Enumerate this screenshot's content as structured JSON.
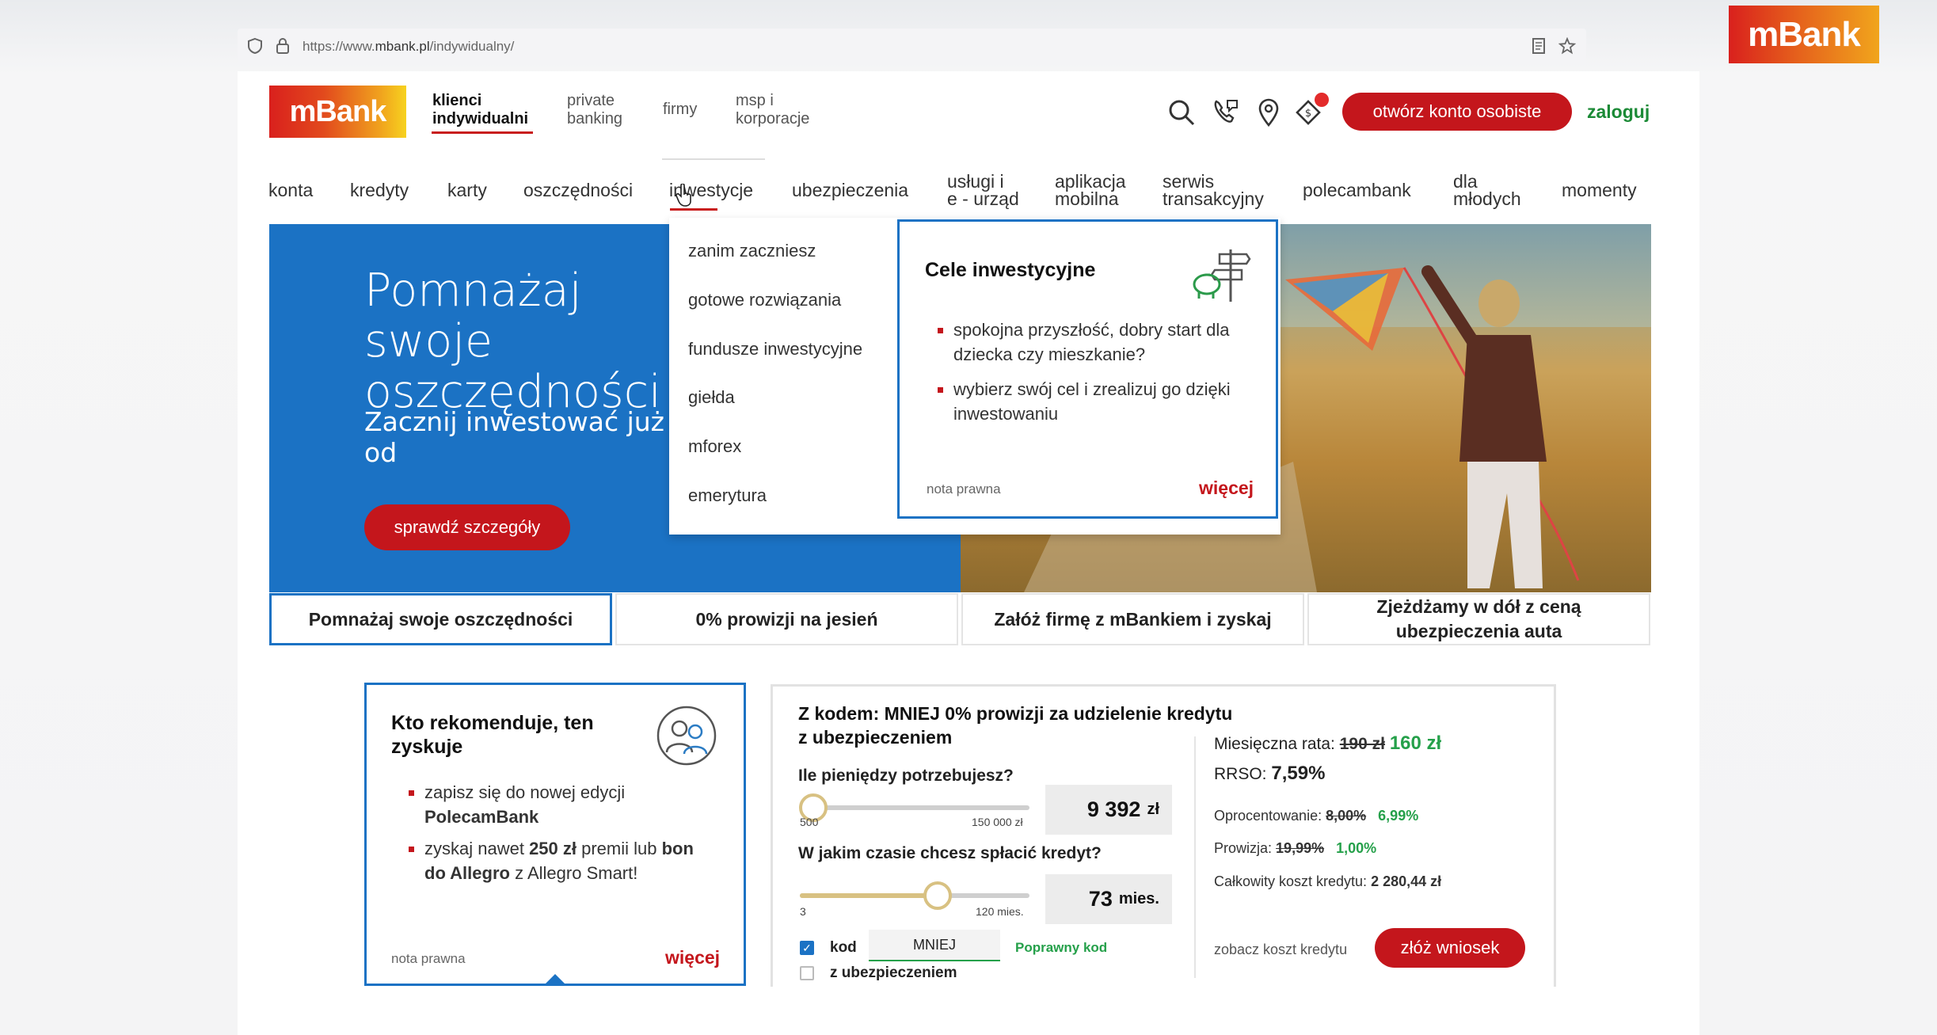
{
  "browser": {
    "url_prefix": "https://www.",
    "url_domain": "mbank.pl",
    "url_path": "/indywidualny/"
  },
  "corner_logo": "mBank",
  "header": {
    "logo": "mBank",
    "segments": [
      "klienci\nindywidualni",
      "private\nbanking",
      "firmy",
      "msp i\nkorporacje"
    ],
    "open_account": "otwórz konto osobiste",
    "login": "zaloguj",
    "icons": [
      "search-icon",
      "phone-chat-icon",
      "location-pin-icon",
      "currency-exchange-icon"
    ]
  },
  "nav": [
    "konta",
    "kredyty",
    "karty",
    "oszczędności",
    "inwestycje",
    "ubezpieczenia",
    "usługi i\ne - urząd",
    "aplikacja\nmobilna",
    "serwis\ntransakcyjny",
    "polecambank",
    "dla\nmłodych",
    "momenty"
  ],
  "dropdown": {
    "items": [
      "zanim zaczniesz",
      "gotowe rozwiązania",
      "fundusze inwestycyjne",
      "giełda",
      "mforex",
      "emerytura"
    ],
    "panel_title": "Cele inwestycyjne",
    "bullets": [
      "spokojna przyszłość, dobry start dla dziecka czy mieszkanie?",
      "wybierz swój cel i zrealizuj go dzięki inwestowaniu"
    ],
    "legal": "nota prawna",
    "more": "więcej"
  },
  "hero": {
    "title": "Pomnażaj swoje oszczędności",
    "subtitle": "Zacznij inwestować już od",
    "button": "sprawdź szczegóły"
  },
  "tabs": [
    "Pomnażaj swoje oszczędności",
    "0% prowizji na jesień",
    "Załóż firmę z mBankiem i zyskaj",
    "Zjeżdżamy w dół z ceną ubezpieczenia auta"
  ],
  "recommend": {
    "title": "Kto rekomenduje, ten zyskuje",
    "b1_pre": "zapisz się do nowej edycji ",
    "b1_bold": "PolecamBank",
    "b2_pre": "zyskaj nawet ",
    "b2_bold1": "250 zł",
    "b2_mid": " premii lub ",
    "b2_bold2": "bon do Allegro",
    "b2_post": " z Allegro Smart!",
    "legal": "nota prawna",
    "more": "więcej"
  },
  "loan": {
    "title": "Z kodem: MNIEJ 0% prowizji za udzielenie kredytu z ubezpieczeniem",
    "q_amount": "Ile pieniędzy potrzebujesz?",
    "amount_min": "500",
    "amount_max": "150 000 zł",
    "amount_value": "9 392",
    "amount_unit": "zł",
    "amount_level": 0.06,
    "q_time": "W jakim czasie chcesz spłacić kredyt?",
    "time_min": "3",
    "time_max": "120 mies.",
    "time_value": "73",
    "time_unit": "mies.",
    "time_level": 0.6,
    "code_label": "kod",
    "code_value": "MNIEJ",
    "code_ok": "Poprawny kod",
    "insurance_label": "z ubezpieczeniem",
    "monthly_label": "Miesięczna rata:",
    "monthly_old": "190 zł",
    "monthly_new": "160 zł",
    "rrso_label": "RRSO:",
    "rrso_value": "7,59%",
    "rate_label": "Oprocentowanie:",
    "rate_old": "8,00%",
    "rate_new": "6,99%",
    "fee_label": "Prowizja:",
    "fee_old": "19,99%",
    "fee_new": "1,00%",
    "total_label": "Całkowity koszt kredytu:",
    "total_value": "2 280,44 zł",
    "see_cost": "zobacz koszt kredytu",
    "apply": "złóż wniosek"
  },
  "colors": {
    "brand_red": "#c4161c",
    "brand_blue": "#1b72c4",
    "green": "#25a04a"
  }
}
